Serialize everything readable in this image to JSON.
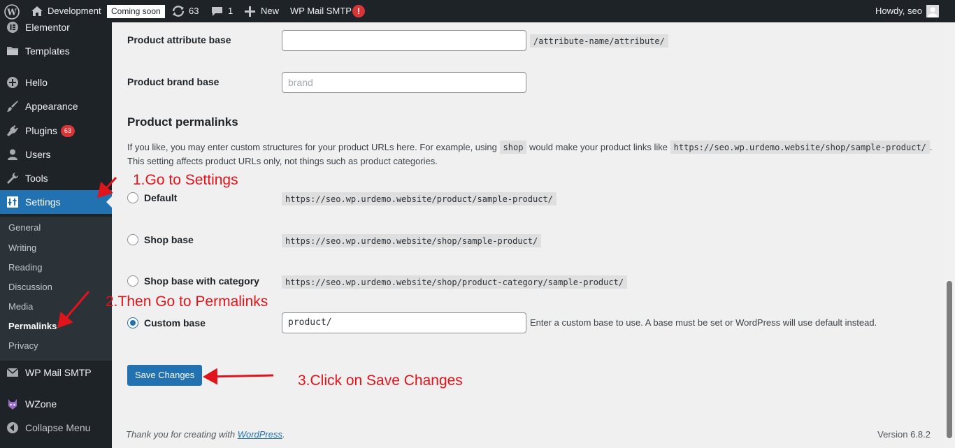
{
  "adminbar": {
    "site_name": "Development",
    "coming_soon": "Coming soon",
    "updates_count": "63",
    "comments_count": "1",
    "new_label": "New",
    "smtp_label": "WP Mail SMTP",
    "smtp_alert": "!",
    "howdy": "Howdy, seo"
  },
  "sidebar": {
    "items": [
      {
        "label": "Elementor",
        "icon": "elementor-icon"
      },
      {
        "label": "Templates",
        "icon": "folder-icon"
      },
      {
        "label": "Hello",
        "icon": "plus-circle-icon"
      },
      {
        "label": "Appearance",
        "icon": "brush-icon"
      },
      {
        "label": "Plugins",
        "icon": "plug-icon",
        "badge": "63"
      },
      {
        "label": "Users",
        "icon": "user-icon"
      },
      {
        "label": "Tools",
        "icon": "wrench-icon"
      },
      {
        "label": "Settings",
        "icon": "settings-icon"
      },
      {
        "label": "WP Mail SMTP",
        "icon": "mail-icon"
      },
      {
        "label": "WZone",
        "icon": "wzone-icon"
      },
      {
        "label": "Collapse Menu",
        "icon": "collapse-icon"
      }
    ],
    "submenu": [
      "General",
      "Writing",
      "Reading",
      "Discussion",
      "Media",
      "Permalinks",
      "Privacy"
    ]
  },
  "form": {
    "attribute_base_label": "Product attribute base",
    "attribute_base_value": "",
    "attribute_base_example": "/attribute-name/attribute/",
    "brand_base_label": "Product brand base",
    "brand_base_placeholder": "brand",
    "section_title": "Product permalinks",
    "description_line1_a": "If you like, you may enter custom structures for your product URLs here. For example, using",
    "description_code1": "shop",
    "description_line1_b": "would make your product links like",
    "description_code2": "https://seo.wp.urdemo.website/shop/sample-product/",
    "description_line1_c": ".",
    "description_line2": "This setting affects product URLs only, not things such as product categories.",
    "options": [
      {
        "label": "Default",
        "example": "https://seo.wp.urdemo.website/product/sample-product/",
        "checked": false
      },
      {
        "label": "Shop base",
        "example": "https://seo.wp.urdemo.website/shop/sample-product/",
        "checked": false
      },
      {
        "label": "Shop base with category",
        "example": "https://seo.wp.urdemo.website/shop/product-category/sample-product/",
        "checked": false
      },
      {
        "label": "Custom base",
        "example": "",
        "checked": true
      }
    ],
    "custom_base_value": "product/",
    "custom_base_hint": "Enter a custom base to use. A base must be set or WordPress will use default instead.",
    "save_label": "Save Changes"
  },
  "annotations": {
    "step1": "1.Go to Settings",
    "step2": "2.Then Go to Permalinks",
    "step3": "3.Click on Save Changes",
    "color": "#e0141b"
  },
  "footer": {
    "thanks_prefix": "Thank you for creating with",
    "thanks_link": "WordPress",
    "thanks_suffix": ".",
    "version": "Version 6.8.2"
  },
  "colors": {
    "adminbar": "#1d2327",
    "sidebar": "#1d2327",
    "submenu": "#2c3338",
    "accent": "#2271b1",
    "badge": "#d63638",
    "background": "#f0f0f1"
  }
}
